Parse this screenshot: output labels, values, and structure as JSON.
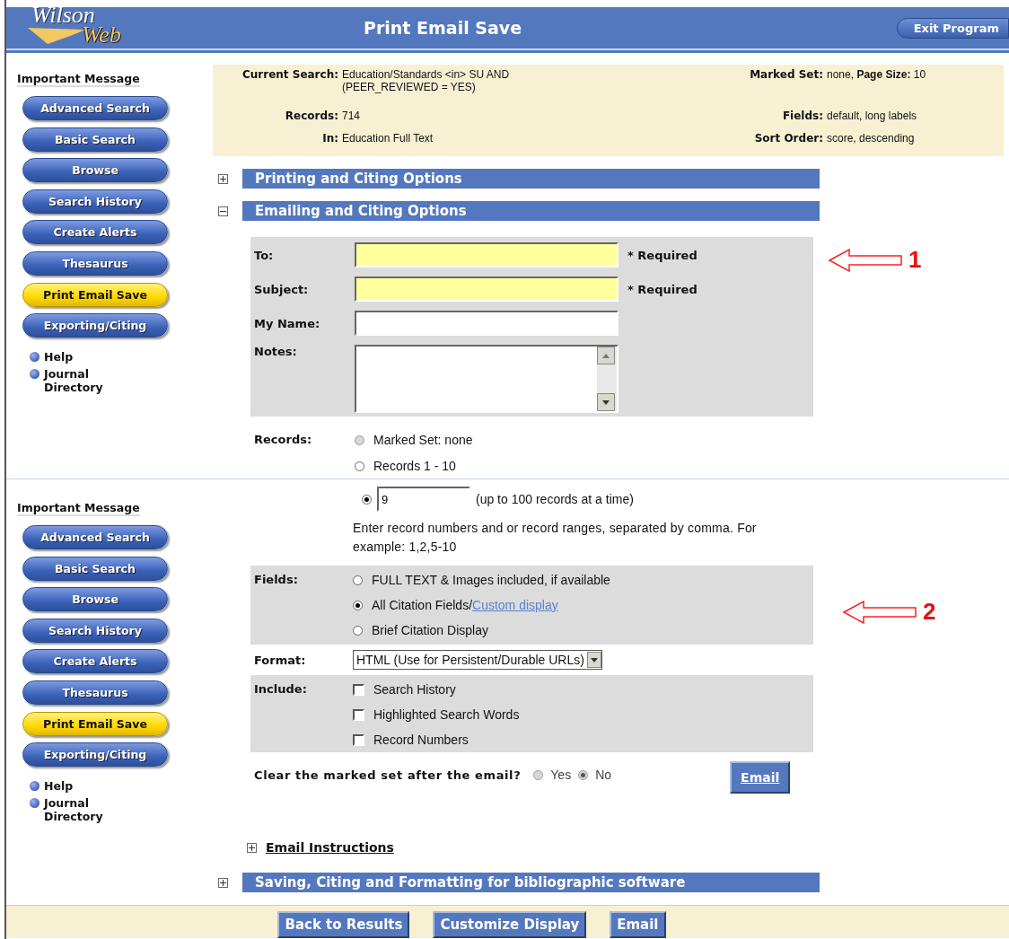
{
  "header": {
    "logo_lines": [
      "Wilson",
      "Web"
    ],
    "title": "Print Email Save",
    "exit_button": "Exit Program"
  },
  "sidebars": [
    {
      "heading": "Important Message",
      "buttons": [
        {
          "label": "Advanced Search",
          "selected": false
        },
        {
          "label": "Basic Search",
          "selected": false
        },
        {
          "label": "Browse",
          "selected": false
        },
        {
          "label": "Search History",
          "selected": false
        },
        {
          "label": "Create Alerts",
          "selected": false
        },
        {
          "label": "Thesaurus",
          "selected": false
        },
        {
          "label": "Print Email Save",
          "selected": true
        },
        {
          "label": "Exporting/Citing",
          "selected": false
        }
      ],
      "links": [
        "Help",
        "Journal Directory"
      ]
    },
    {
      "heading": "Important Message",
      "buttons": [
        {
          "label": "Advanced Search",
          "selected": false
        },
        {
          "label": "Basic Search",
          "selected": false
        },
        {
          "label": "Browse",
          "selected": false
        },
        {
          "label": "Search History",
          "selected": false
        },
        {
          "label": "Create Alerts",
          "selected": false
        },
        {
          "label": "Thesaurus",
          "selected": false
        },
        {
          "label": "Print Email Save",
          "selected": true
        },
        {
          "label": "Exporting/Citing",
          "selected": false
        }
      ],
      "links": [
        "Help",
        "Journal Directory"
      ]
    }
  ],
  "search_summary": {
    "left": [
      {
        "label": "Current Search:",
        "value": "Education/Standards <in> SU AND (PEER_REVIEWED = YES)"
      },
      {
        "label": "Records:",
        "value": "714"
      },
      {
        "label": "In:",
        "value": "Education Full Text"
      }
    ],
    "right": [
      {
        "label": "Marked Set:",
        "value": "none, **Page Size:** 10"
      },
      {
        "label": "Fields:",
        "value": "default, long labels"
      },
      {
        "label": "Sort Order:",
        "value": "score, descending"
      }
    ]
  },
  "sections_top": [
    {
      "title": "Printing and Citing Options",
      "expanded": false
    },
    {
      "title": "Emailing and Citing Options",
      "expanded": true
    }
  ],
  "email_form": {
    "fields": [
      {
        "label": "To:",
        "kind": "text",
        "required": true,
        "note": "* Required"
      },
      {
        "label": "Subject:",
        "kind": "text",
        "required": true,
        "note": "* Required"
      },
      {
        "label": "My Name:",
        "kind": "text",
        "required": false
      },
      {
        "label": "Notes:",
        "kind": "textarea",
        "required": false
      }
    ],
    "callout": "1",
    "records": {
      "label": "Records:",
      "options": [
        {
          "label": "Marked Set: none",
          "selected": false,
          "disabled": true
        },
        {
          "label": "Records 1 - 10",
          "selected": false,
          "disabled": false
        }
      ]
    }
  },
  "records_range": {
    "selected": true,
    "value": "9",
    "hint": "(up to 100 records at a time)",
    "help": "Enter record numbers and or record ranges, separated by comma. For example: 1,2,5-10"
  },
  "fields_group": {
    "label": "Fields:",
    "options": [
      {
        "label": "FULL TEXT & Images included, if available",
        "selected": false
      },
      {
        "label": "All Citation Fields/",
        "link": "Custom display",
        "selected": true
      },
      {
        "label": "Brief Citation Display",
        "selected": false
      }
    ],
    "callout": "2"
  },
  "format": {
    "label": "Format:",
    "value": "HTML (Use for Persistent/Durable URLs)"
  },
  "include": {
    "label": "Include:",
    "options": [
      {
        "label": "Search History",
        "checked": false
      },
      {
        "label": "Highlighted Search Words",
        "checked": false
      },
      {
        "label": "Record Numbers",
        "checked": false
      }
    ]
  },
  "clear_marked": {
    "question": "Clear the marked set after the email?",
    "options": [
      {
        "label": "Yes",
        "selected": false
      },
      {
        "label": "No",
        "selected": true
      }
    ],
    "button": "Email"
  },
  "email_instructions": {
    "title": "Email Instructions",
    "expanded": false
  },
  "sections_bottom": [
    {
      "title": "Saving, Citing and Formatting for bibliographic software",
      "expanded": false
    }
  ],
  "footer_buttons": [
    "Back to Results",
    "Customize Display",
    "Email"
  ]
}
